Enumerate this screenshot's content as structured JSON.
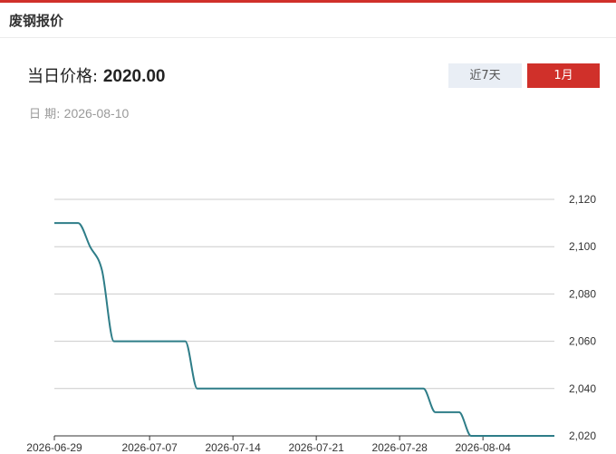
{
  "header": {
    "title": "废钢报价"
  },
  "summary": {
    "price_label": "当日价格:",
    "price_value": "2020.00",
    "date_label": "日 期:",
    "date_value": "2026-08-10"
  },
  "range_buttons": {
    "last7_label": "近7天",
    "month_label": "1月",
    "active": "1月"
  },
  "colors": {
    "accent": "#d0302a",
    "inactive_button_bg": "#e9eef5",
    "line": "#2e7d88",
    "grid": "#cccccc"
  },
  "chart_data": {
    "type": "line",
    "x_ticks": [
      "2026-06-29",
      "2026-07-07",
      "2026-07-14",
      "2026-07-21",
      "2026-07-28",
      "2026-08-04"
    ],
    "y_ticks": [
      "2,020",
      "2,040",
      "2,060",
      "2,080",
      "2,100",
      "2,120"
    ],
    "ylim": [
      2020,
      2120
    ],
    "xlim": [
      "2026-06-29",
      "2026-08-10"
    ],
    "grid": true,
    "y_axis_side": "right",
    "series": [
      {
        "x": [
          "2026-06-29",
          "2026-06-30",
          "2026-07-01",
          "2026-07-02",
          "2026-07-03",
          "2026-07-04",
          "2026-07-05",
          "2026-07-06",
          "2026-07-07",
          "2026-07-08",
          "2026-07-09",
          "2026-07-10",
          "2026-07-11",
          "2026-07-12",
          "2026-07-13",
          "2026-07-14",
          "2026-07-15",
          "2026-07-16",
          "2026-07-17",
          "2026-07-18",
          "2026-07-19",
          "2026-07-20",
          "2026-07-21",
          "2026-07-22",
          "2026-07-23",
          "2026-07-24",
          "2026-07-25",
          "2026-07-26",
          "2026-07-27",
          "2026-07-28",
          "2026-07-29",
          "2026-07-30",
          "2026-07-31",
          "2026-08-01",
          "2026-08-02",
          "2026-08-03",
          "2026-08-04",
          "2026-08-05",
          "2026-08-06",
          "2026-08-07",
          "2026-08-08",
          "2026-08-09",
          "2026-08-10"
        ],
        "values": [
          2110,
          2110,
          2110,
          2100,
          2090,
          2060,
          2060,
          2060,
          2060,
          2060,
          2060,
          2060,
          2040,
          2040,
          2040,
          2040,
          2040,
          2040,
          2040,
          2040,
          2040,
          2040,
          2040,
          2040,
          2040,
          2040,
          2040,
          2040,
          2040,
          2040,
          2040,
          2040,
          2030,
          2030,
          2030,
          2020,
          2020,
          2020,
          2020,
          2020,
          2020,
          2020,
          2020
        ]
      }
    ]
  }
}
